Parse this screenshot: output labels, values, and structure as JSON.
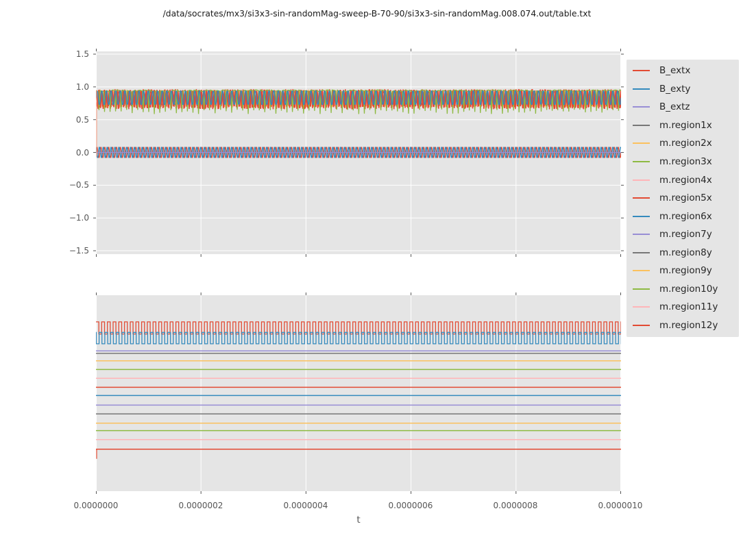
{
  "title": "/data/socrates/mx3/si3x3-sin-randomMag-sweep-B-70-90/si3x3-sin-randomMag.008.074.out/table.txt",
  "colors": {
    "figure_bg": "#ffffff",
    "plot_bg": "#e5e5e5",
    "grid": "#ffffff",
    "tick": "#555555",
    "tick_label": "#555555",
    "title_text": "#1a1a1a",
    "legend_bg": "#e5e5e5",
    "legend_text": "#262626",
    "palette_red": "#e24a33",
    "palette_blue": "#348abd",
    "palette_purple": "#988ed5",
    "palette_gray": "#777777",
    "palette_orange": "#fbc15e",
    "palette_green": "#8eba42",
    "palette_pink": "#ffb5b8"
  },
  "axes": {
    "x": {
      "label": "t",
      "tick_labels": [
        "0.0000000",
        "0.0000002",
        "0.0000004",
        "0.0000006",
        "0.0000008",
        "0.0000010"
      ],
      "tick_fracs": [
        0,
        0.2,
        0.4,
        0.6,
        0.8,
        1.0
      ],
      "range": [
        0,
        1e-06
      ]
    },
    "y_top": {
      "tick_labels": [
        "1.5",
        "1.0",
        "0.5",
        "0.0",
        "−0.5",
        "−1.0",
        "−1.5"
      ],
      "tick_values": [
        1.5,
        1.0,
        0.5,
        0.0,
        -0.5,
        -1.0,
        -1.5
      ],
      "range": [
        -1.55,
        1.54
      ]
    },
    "y_bottom": {
      "tick_labels": [],
      "range": null
    }
  },
  "legend": {
    "entries": [
      {
        "label": "B_extx",
        "color": "#e24a33"
      },
      {
        "label": "B_exty",
        "color": "#348abd"
      },
      {
        "label": "B_extz",
        "color": "#988ed5"
      },
      {
        "label": "m.region1x",
        "color": "#777777"
      },
      {
        "label": "m.region2x",
        "color": "#fbc15e"
      },
      {
        "label": "m.region3x",
        "color": "#8eba42"
      },
      {
        "label": "m.region4x",
        "color": "#ffb5b8"
      },
      {
        "label": "m.region5x",
        "color": "#e24a33"
      },
      {
        "label": "m.region6x",
        "color": "#348abd"
      },
      {
        "label": "m.region7y",
        "color": "#988ed5"
      },
      {
        "label": "m.region8y",
        "color": "#777777"
      },
      {
        "label": "m.region9y",
        "color": "#fbc15e"
      },
      {
        "label": "m.region10y",
        "color": "#8eba42"
      },
      {
        "label": "m.region11y",
        "color": "#ffb5b8"
      },
      {
        "label": "m.region12y",
        "color": "#e24a33"
      }
    ]
  },
  "chart_data": [
    {
      "type": "line",
      "subplot": "top",
      "xlabel": "t",
      "xlim": [
        0,
        1e-06
      ],
      "ylim": [
        -1.55,
        1.54
      ],
      "xticks": [
        0,
        2e-07,
        4e-07,
        6e-07,
        8e-07,
        1e-06
      ],
      "yticks": [
        1.5,
        1.0,
        0.5,
        0.0,
        -0.5,
        -1.0,
        -1.5
      ],
      "grid": true,
      "description": "Dense high-frequency oscillations: m.region x-components oscillate in a band ~0.58..0.97; B_extx/B_exty are ~±0.09 sinusoids about 0; B_extz constant 0.",
      "series": [
        {
          "name": "m.region1x",
          "color": "#777777",
          "shape": "sine",
          "mid": 0.83,
          "amp": 0.11,
          "cycles": 117,
          "phase": 0.7,
          "jitter": 0.02,
          "lw": 1.2
        },
        {
          "name": "m.region2x",
          "color": "#fbc15e",
          "shape": "sine",
          "mid": 0.82,
          "amp": 0.13,
          "cycles": 121,
          "phase": 1.9,
          "jitter": 0.02,
          "lw": 1.2
        },
        {
          "name": "m.region4x",
          "color": "#ffb5b8",
          "shape": "sine",
          "mid": 0.82,
          "amp": 0.13,
          "cycles": 119,
          "phase": 3.6,
          "jitter": 0.02,
          "lw": 1.2
        },
        {
          "name": "m.region5x",
          "color": "#e24a33",
          "shape": "zigzag",
          "hi": 0.965,
          "lo": 0.675,
          "cycles": 200,
          "passes": 2,
          "lw": 1.5
        },
        {
          "name": "m.region3x",
          "color": "#8eba42",
          "shape": "spikes",
          "base": 0.945,
          "spike_to": 0.585,
          "cycles": 95,
          "lw": 1.3
        },
        {
          "name": "m.region6x",
          "color": "#348abd",
          "shape": "sine",
          "mid": 0.835,
          "amp": 0.115,
          "cycles": 113,
          "phase": 0.0,
          "jitter": 0.015,
          "lw": 1.4
        },
        {
          "name": "B_extx",
          "color": "#e24a33",
          "shape": "sine",
          "mid": 0.0,
          "amp": 0.088,
          "cycles": 135,
          "phase": 0.0,
          "jitter": 0.0,
          "lw": 1.4
        },
        {
          "name": "B_exty",
          "color": "#348abd",
          "shape": "sine",
          "mid": 0.0,
          "amp": 0.088,
          "cycles": 135,
          "phase": 2.1,
          "jitter": 0.0,
          "lw": 1.4
        },
        {
          "name": "B_extz",
          "color": "#988ed5",
          "shape": "flat",
          "level": 0.0,
          "lw": 1.3
        },
        {
          "name": "startup-transient",
          "color": "#f0a48c",
          "shape": "vline",
          "at_frac": 0.0007,
          "from": 0.95,
          "to": -0.07,
          "lw": 1.2
        }
      ]
    },
    {
      "type": "line",
      "subplot": "bottom",
      "xlabel": "t",
      "xlim": [
        0,
        1e-06
      ],
      "yticks": [],
      "grid": true,
      "description": "Same traces on an expanded scale: B_extx and B_exty appear as square-wave bands at top; all other components are flat horizontal lines (fractions measured from plot top).",
      "series": [
        {
          "name": "B_extx",
          "color": "#e24a33",
          "shape": "square",
          "hi_frac": 0.136,
          "lo_frac": 0.198,
          "cycles": 92,
          "duty": 0.5,
          "phase": 0.0,
          "lw": 1.3
        },
        {
          "name": "B_exty",
          "color": "#348abd",
          "shape": "square",
          "hi_frac": 0.19,
          "lo_frac": 0.248,
          "cycles": 92,
          "duty": 0.5,
          "phase": 0.45,
          "lw": 1.3
        },
        {
          "name": "B_extz",
          "color": "#988ed5",
          "shape": "flat",
          "y_frac": 0.284,
          "lw": 1.5
        },
        {
          "name": "m.region1x",
          "color": "#777777",
          "shape": "flat",
          "y_frac": 0.297,
          "lw": 1.5
        },
        {
          "name": "m.region2x",
          "color": "#fbc15e",
          "shape": "flat",
          "y_frac": 0.335,
          "lw": 1.5
        },
        {
          "name": "m.region3x",
          "color": "#8eba42",
          "shape": "flat",
          "y_frac": 0.379,
          "lw": 1.5
        },
        {
          "name": "m.region4x",
          "color": "#ffb5b8",
          "shape": "flat",
          "y_frac": 0.424,
          "lw": 1.5
        },
        {
          "name": "m.region5x",
          "color": "#e24a33",
          "shape": "flat",
          "y_frac": 0.47,
          "lw": 1.5
        },
        {
          "name": "m.region6x",
          "color": "#348abd",
          "shape": "flat",
          "y_frac": 0.512,
          "lw": 1.5
        },
        {
          "name": "m.region7y",
          "color": "#988ed5",
          "shape": "flat",
          "y_frac": 0.561,
          "lw": 1.5
        },
        {
          "name": "m.region8y",
          "color": "#777777",
          "shape": "flat",
          "y_frac": 0.606,
          "lw": 1.5
        },
        {
          "name": "m.region9y",
          "color": "#fbc15e",
          "shape": "flat",
          "y_frac": 0.653,
          "lw": 1.5
        },
        {
          "name": "m.region10y",
          "color": "#8eba42",
          "shape": "flat",
          "y_frac": 0.691,
          "lw": 1.5
        },
        {
          "name": "m.region11y",
          "color": "#ffb5b8",
          "shape": "flat",
          "y_frac": 0.737,
          "lw": 1.5
        },
        {
          "name": "m.region12y",
          "color": "#e24a33",
          "shape": "flat",
          "y_frac": 0.786,
          "lw": 1.5
        },
        {
          "name": "startup-transient",
          "color": "#e24a33",
          "shape": "vline",
          "at_frac": 0.0007,
          "from_frac": 0.786,
          "to_frac": 0.835,
          "lw": 1.2
        }
      ]
    }
  ]
}
